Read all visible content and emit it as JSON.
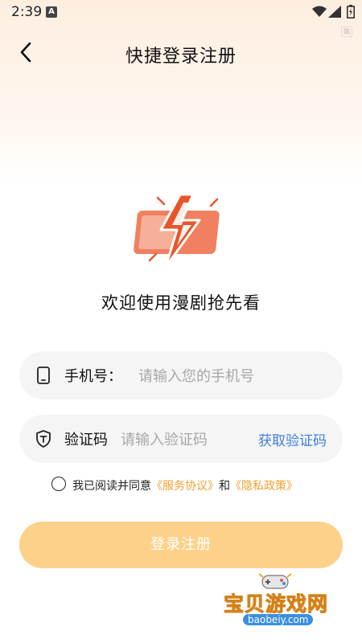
{
  "status_bar": {
    "time": "2:39",
    "notification_icon": "A"
  },
  "corner_badge": "跳",
  "nav": {
    "title": "快捷登录注册"
  },
  "welcome": "欢迎使用漫剧抢先看",
  "phone_field": {
    "label": "手机号：",
    "placeholder": "请输入您的手机号",
    "value": ""
  },
  "code_field": {
    "label": "验证码",
    "placeholder": "请输入验证码",
    "value": "",
    "get_code": "获取验证码"
  },
  "agreement": {
    "prefix": "我已阅读并同意",
    "service_link": "《服务协议》",
    "middle": "和",
    "privacy_link": "《隐私政策》"
  },
  "login_button": "登录注册",
  "watermark": {
    "text": "宝贝游戏网",
    "url": "baobeiy.com"
  },
  "colors": {
    "accent": "#3d7ee0",
    "link": "#f0a030",
    "button": "#fdd18a",
    "logo_orange": "#e8552a"
  }
}
